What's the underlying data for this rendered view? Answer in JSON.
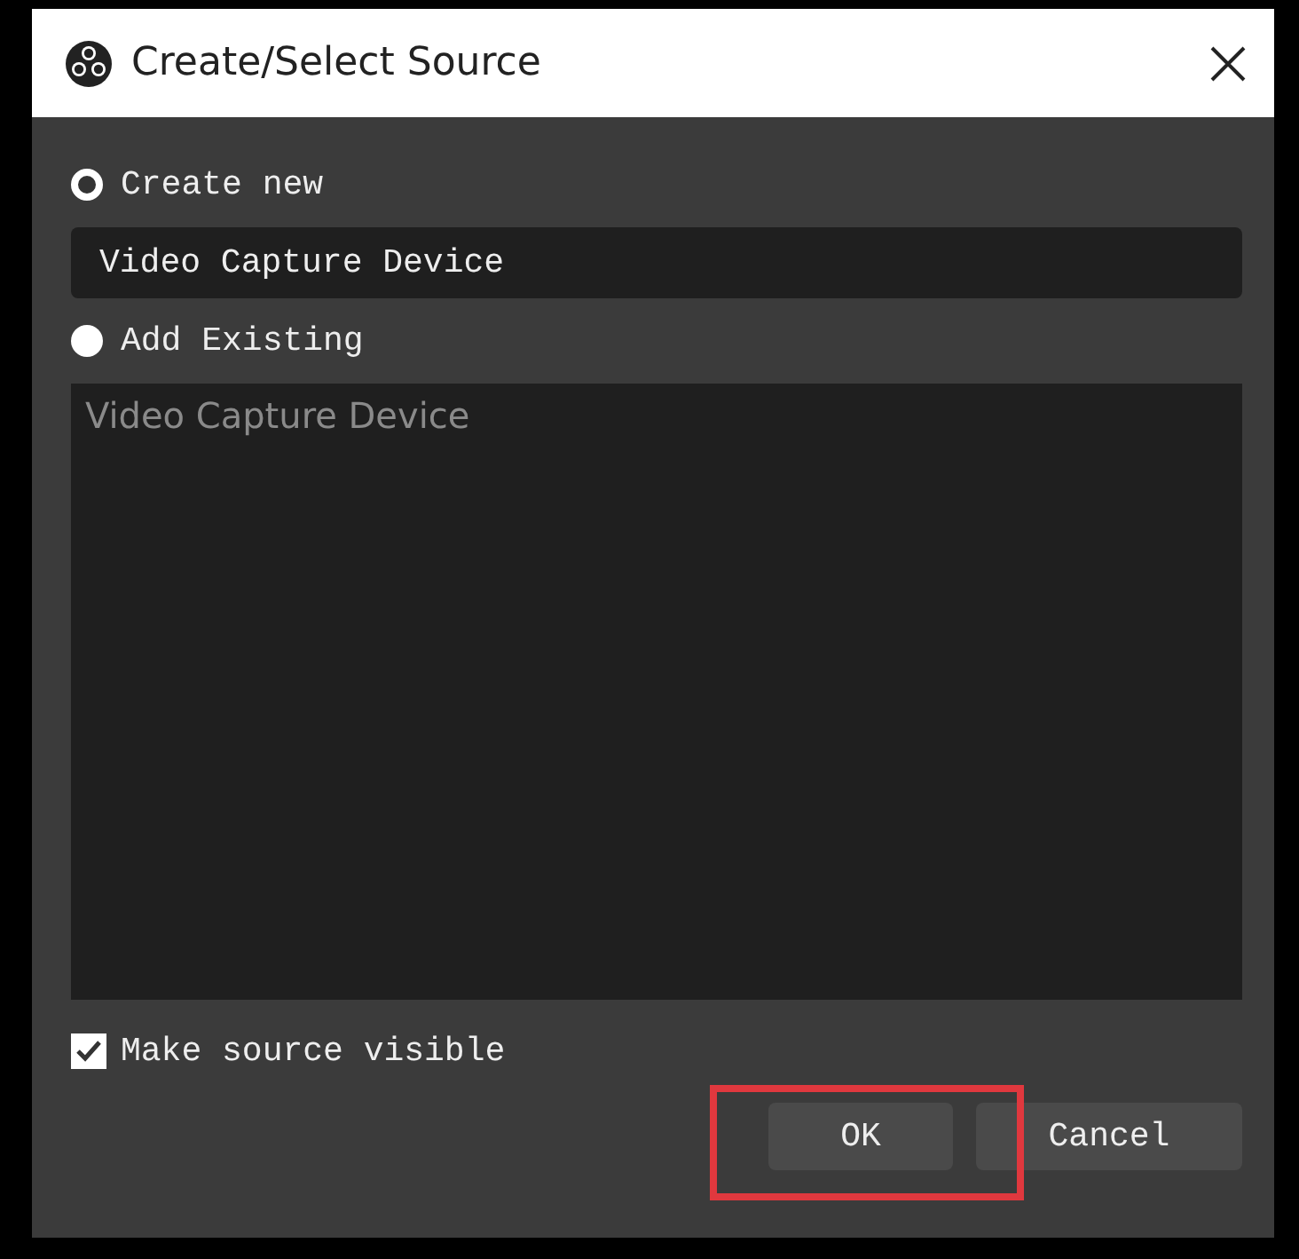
{
  "window": {
    "title": "Create/Select Source"
  },
  "options": [
    {
      "kind": "create",
      "label": "Create new",
      "selected": true,
      "value": "Video Capture Device"
    },
    {
      "kind": "existing",
      "label": "Add Existing",
      "selected": false,
      "items": [
        "Video Capture Device"
      ]
    }
  ],
  "visible_checkbox": {
    "label": "Make source visible",
    "checked": true
  },
  "buttons": [
    {
      "label": "OK",
      "highlighted": true
    },
    {
      "label": "Cancel",
      "highlighted": false
    }
  ]
}
